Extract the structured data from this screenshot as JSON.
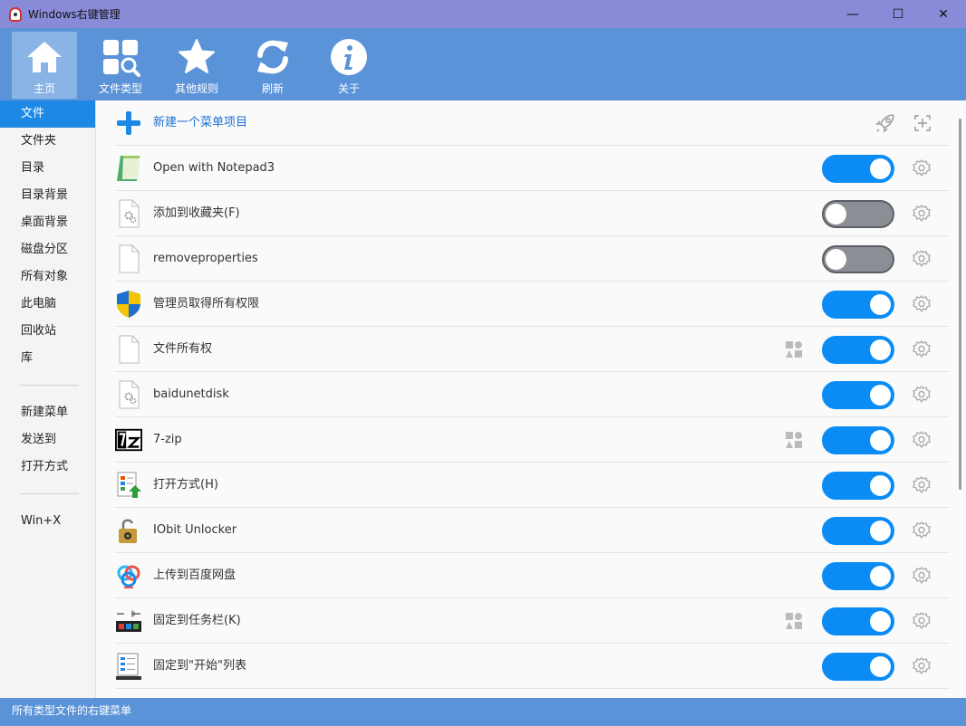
{
  "window": {
    "title": "Windows右键管理",
    "minimize": "—",
    "maximize": "☐",
    "close": "✕"
  },
  "toolbar": {
    "items": [
      {
        "label": "主页",
        "icon": "home-icon",
        "active": true
      },
      {
        "label": "文件类型",
        "icon": "file-types-icon",
        "active": false
      },
      {
        "label": "其他规则",
        "icon": "star-icon",
        "active": false
      },
      {
        "label": "刷新",
        "icon": "refresh-icon",
        "active": false
      },
      {
        "label": "关于",
        "icon": "info-icon",
        "active": false
      }
    ]
  },
  "sidebar": {
    "group1": [
      "文件",
      "文件夹",
      "目录",
      "目录背景",
      "桌面背景",
      "磁盘分区",
      "所有对象",
      "此电脑",
      "回收站",
      "库"
    ],
    "group2": [
      "新建菜单",
      "发送到",
      "打开方式"
    ],
    "group3": [
      "Win+X"
    ],
    "active": "文件"
  },
  "content": {
    "new_item_label": "新建一个菜单项目",
    "items": [
      {
        "label": "Open with Notepad3",
        "icon": "notepad3-icon",
        "enabled": true,
        "shapes": false
      },
      {
        "label": "添加到收藏夹(F)",
        "icon": "settings-file-icon",
        "enabled": false,
        "shapes": false
      },
      {
        "label": "removeproperties",
        "icon": "blank-file-icon",
        "enabled": false,
        "shapes": false
      },
      {
        "label": "管理员取得所有权限",
        "icon": "uac-shield-icon",
        "enabled": true,
        "shapes": false
      },
      {
        "label": "文件所有权",
        "icon": "blank-file-icon",
        "enabled": true,
        "shapes": true
      },
      {
        "label": "baidunetdisk",
        "icon": "settings-file-icon",
        "enabled": true,
        "shapes": false
      },
      {
        "label": "7-zip",
        "icon": "7zip-icon",
        "enabled": true,
        "shapes": true
      },
      {
        "label": "打开方式(H)",
        "icon": "open-with-icon",
        "enabled": true,
        "shapes": false
      },
      {
        "label": "IObit Unlocker",
        "icon": "unlocker-icon",
        "enabled": true,
        "shapes": false
      },
      {
        "label": "上传到百度网盘",
        "icon": "baidu-cloud-icon",
        "enabled": true,
        "shapes": false
      },
      {
        "label": "固定到任务栏(K)",
        "icon": "pin-taskbar-icon",
        "enabled": true,
        "shapes": true
      },
      {
        "label": "固定到\"开始\"列表",
        "icon": "pin-start-icon",
        "enabled": true,
        "shapes": false
      }
    ]
  },
  "status": {
    "text": "所有类型文件的右键菜单"
  },
  "colors": {
    "accent": "#0b8cf5",
    "titlebar": "#8a8bd8",
    "toolbar": "#5b93d8",
    "sidebar_active": "#1e88e5"
  }
}
